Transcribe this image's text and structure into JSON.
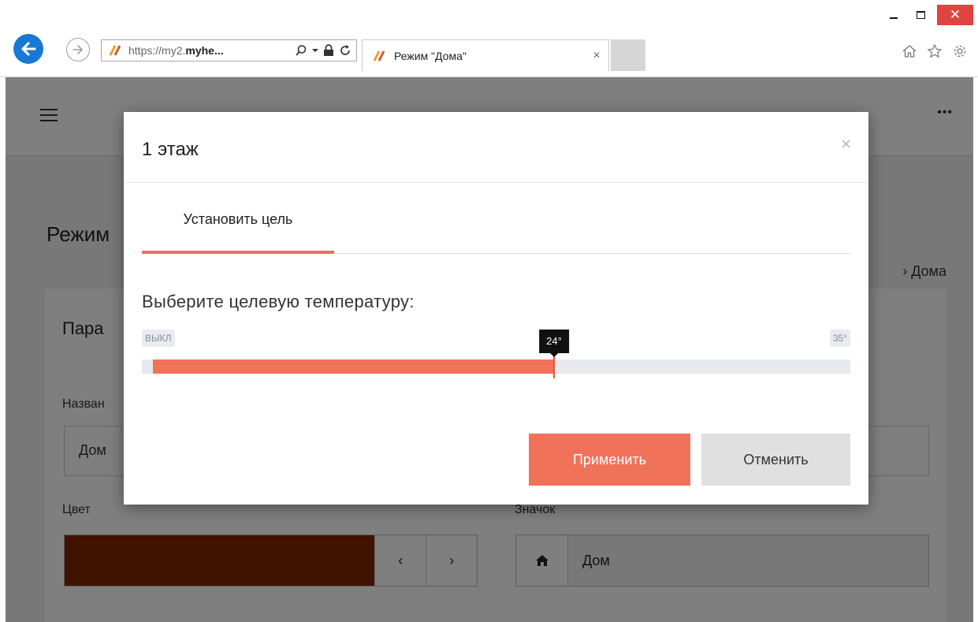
{
  "browser": {
    "url_prefix": "https://",
    "url_dim": "my2.",
    "url_main": "myhe...",
    "tab_title": "Режим \"Дома\"",
    "tab_close": "×",
    "window_close": "✕",
    "colors": {
      "back_button": "#1978d4",
      "close_button": "#e0443e"
    }
  },
  "page": {
    "heading": "Режим",
    "breadcrumb": "› Дома",
    "card_title": "Пара",
    "name_label": "Назван",
    "name_value": "Дом",
    "color_label": "Цвет",
    "color_value": "#7f2600",
    "prev_arrow": "‹",
    "next_arrow": "›",
    "icon_label": "Значок",
    "icon_name": "home-icon",
    "icon_text": "Дом"
  },
  "modal": {
    "title": "1 этаж",
    "close": "×",
    "tab_label": "Установить цель",
    "prompt": "Выберите целевую температуру:",
    "slider": {
      "min_label": "ВЫКЛ",
      "max_label": "35°",
      "value_label": "24°",
      "fraction": 0.575
    },
    "apply_label": "Применить",
    "cancel_label": "Отменить",
    "colors": {
      "accent": "#f07259",
      "cancel_bg": "#e0e0e0"
    }
  }
}
